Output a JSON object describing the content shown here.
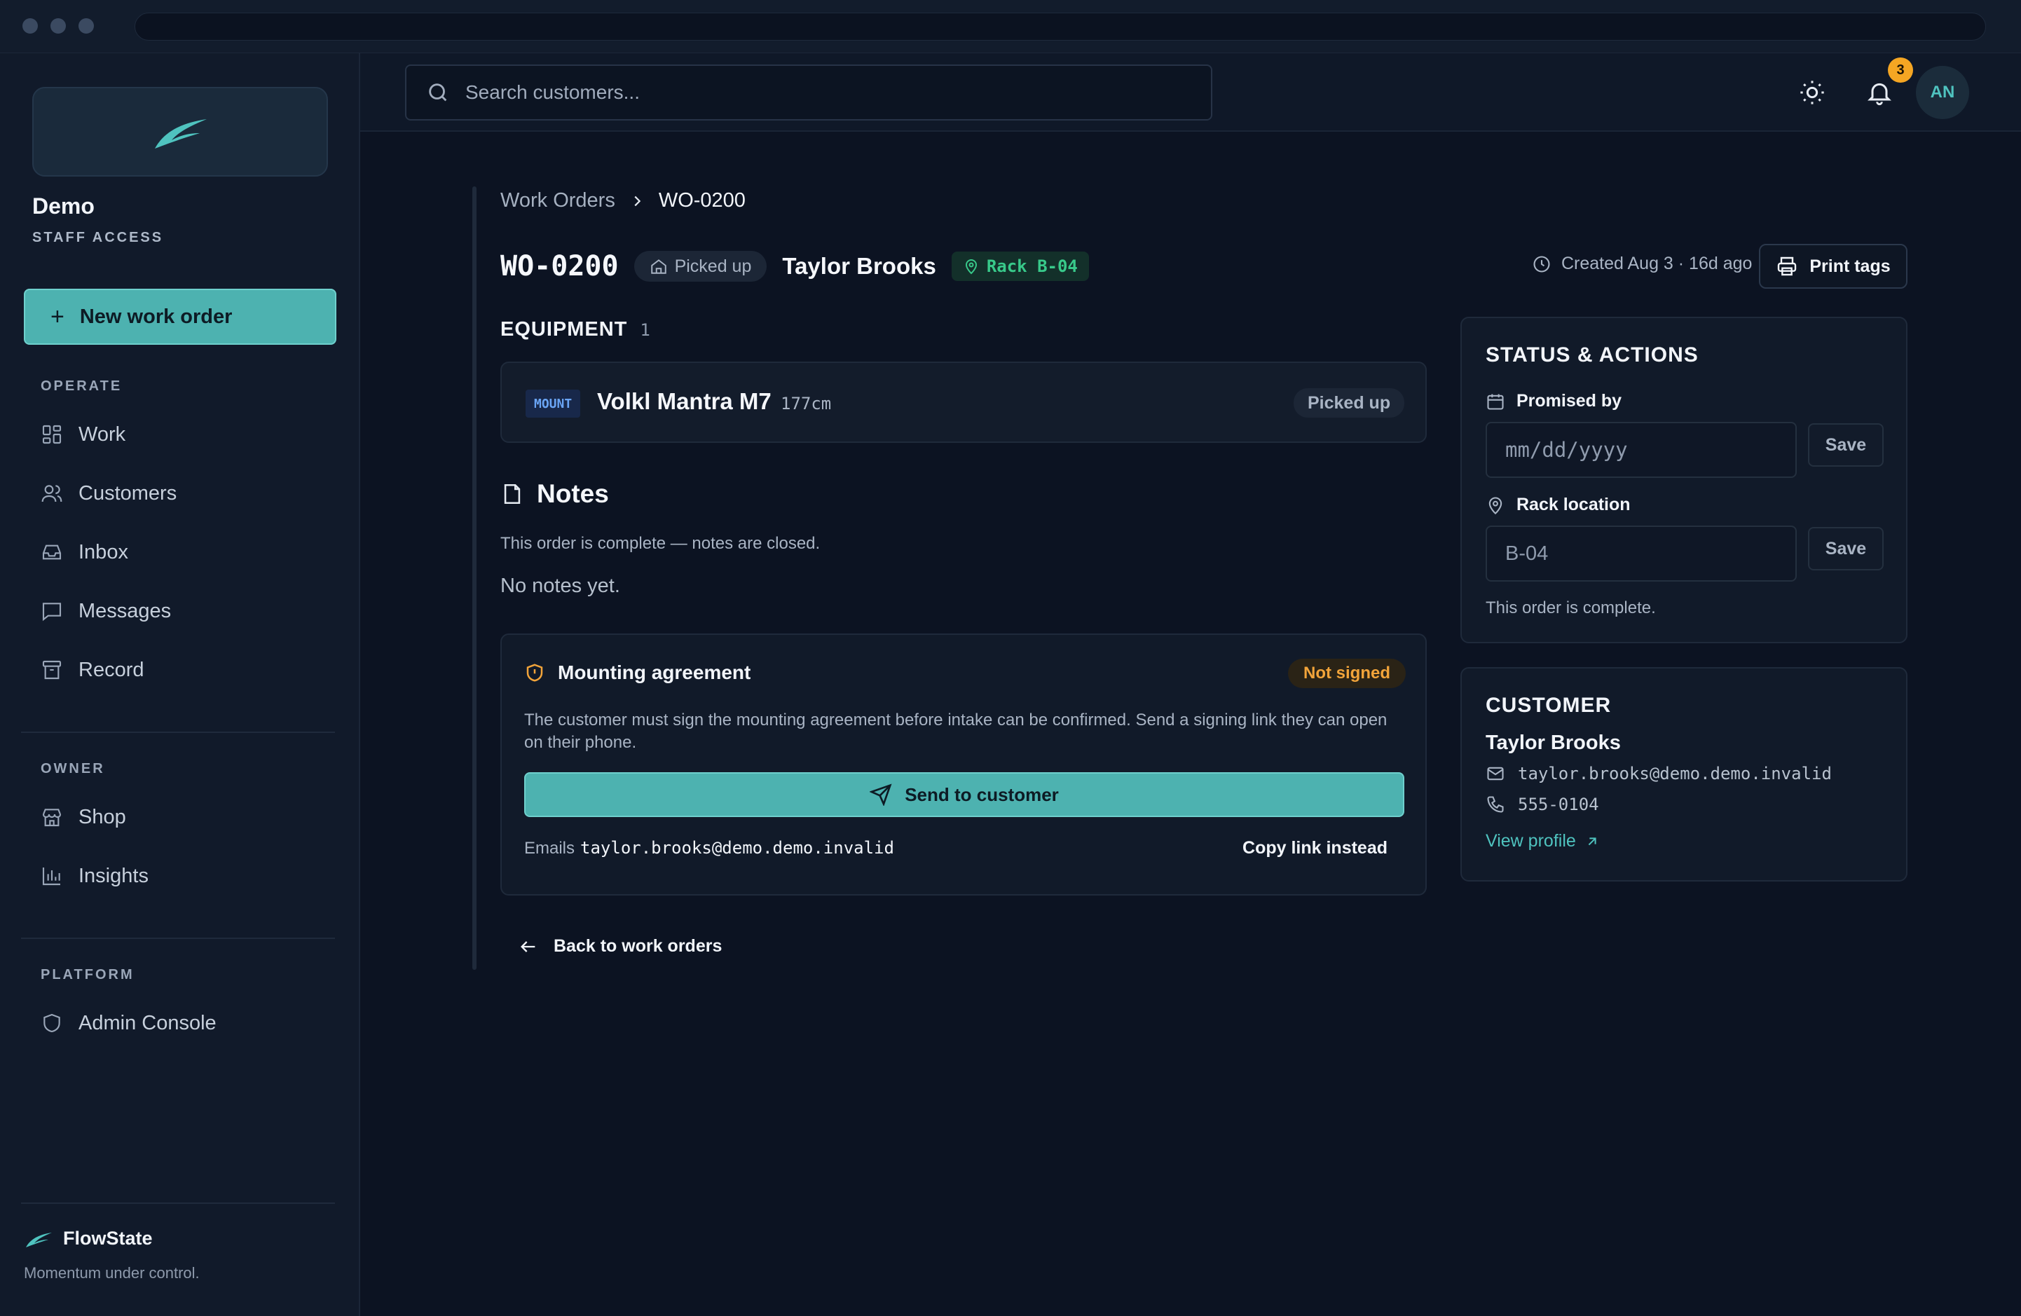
{
  "sidebar": {
    "org_name": "Demo",
    "org_sub": "STAFF ACCESS",
    "new_button": "New work order",
    "sections": {
      "operate": "OPERATE",
      "owner": "OWNER",
      "platform": "PLATFORM"
    },
    "operate_items": [
      "Work",
      "Customers",
      "Inbox",
      "Messages",
      "Record"
    ],
    "owner_items": [
      "Shop",
      "Insights"
    ],
    "platform_items": [
      "Admin Console"
    ],
    "footer_brand": "FlowState",
    "footer_tagline": "Momentum under control."
  },
  "topbar": {
    "search_placeholder": "Search customers...",
    "notification_count": "3",
    "avatar_initials": "AN"
  },
  "breadcrumb": {
    "parent": "Work Orders",
    "current": "WO-0200"
  },
  "order": {
    "id": "WO-0200",
    "status": "Picked up",
    "customer_name": "Taylor Brooks",
    "rack": "Rack B-04",
    "created": "Created Aug 3 · 16d ago",
    "print_label": "Print tags"
  },
  "equipment": {
    "heading": "EQUIPMENT",
    "count": "1",
    "items": [
      {
        "tag": "MOUNT",
        "name": "Volkl Mantra M7",
        "size": "177cm",
        "status": "Picked up"
      }
    ]
  },
  "notes": {
    "heading": "Notes",
    "closed_text": "This order is complete — notes are closed.",
    "empty_text": "No notes yet."
  },
  "agreement": {
    "title": "Mounting agreement",
    "status": "Not signed",
    "description": "The customer must sign the mounting agreement before intake can be confirmed. Send a signing link they can open on their phone.",
    "send_label": "Send to customer",
    "emails_prefix": "Emails",
    "email": "taylor.brooks@demo.demo.invalid",
    "copy_label": "Copy link instead"
  },
  "back_label": "Back to work orders",
  "status_panel": {
    "title": "STATUS & ACTIONS",
    "promised_label": "Promised by",
    "promised_placeholder": "mm/dd/yyyy",
    "rack_label": "Rack location",
    "rack_value": "B-04",
    "save_label": "Save",
    "complete_note": "This order is complete."
  },
  "customer_panel": {
    "title": "CUSTOMER",
    "name": "Taylor Brooks",
    "email": "taylor.brooks@demo.demo.invalid",
    "phone": "555-0104",
    "view_profile": "View profile"
  },
  "colors": {
    "accent": "#4db2b0",
    "success": "#38c98a",
    "warning": "#f2a43a",
    "info": "#6aa5f5",
    "background": "#0c1322"
  }
}
